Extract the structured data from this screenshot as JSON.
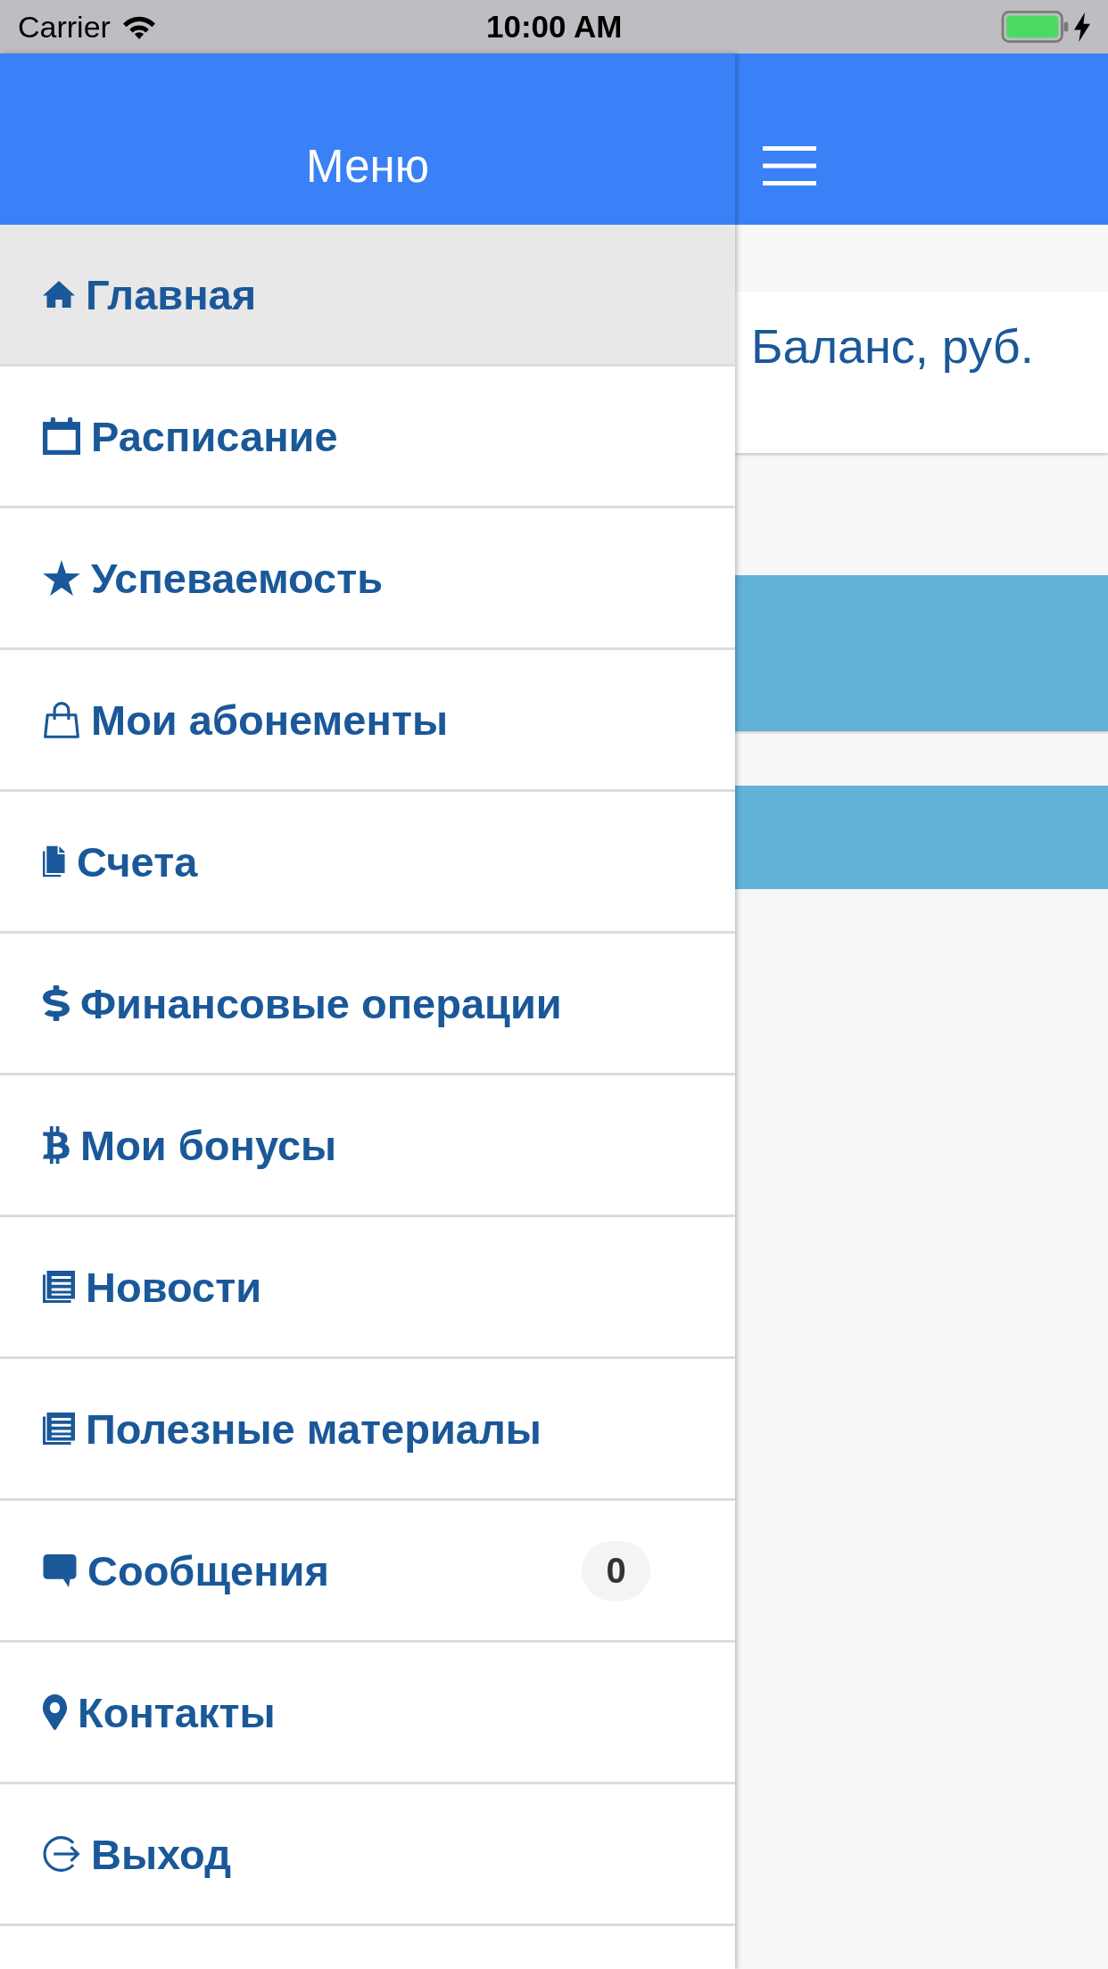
{
  "status_bar": {
    "carrier": "Carrier",
    "time": "10:00 AM"
  },
  "drawer": {
    "title": "Меню",
    "items": [
      {
        "label": "Главная",
        "selected": true
      },
      {
        "label": "Расписание",
        "selected": false
      },
      {
        "label": "Успеваемость",
        "selected": false
      },
      {
        "label": "Мои абонементы",
        "selected": false
      },
      {
        "label": "Счета",
        "selected": false
      },
      {
        "label": "Финансовые операции",
        "selected": false
      },
      {
        "label": "Мои бонусы",
        "selected": false
      },
      {
        "label": "Новости",
        "selected": false
      },
      {
        "label": "Полезные материалы",
        "selected": false
      },
      {
        "label": "Сообщения",
        "selected": false,
        "badge": "0"
      },
      {
        "label": "Контакты",
        "selected": false
      },
      {
        "label": "Выход",
        "selected": false
      }
    ]
  },
  "main": {
    "balance_label": "Баланс, руб."
  }
}
